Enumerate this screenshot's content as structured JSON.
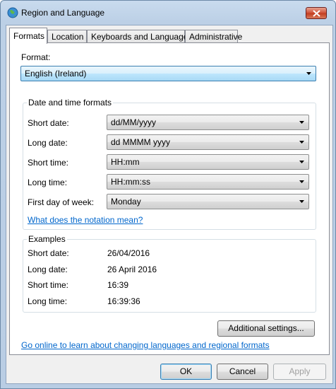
{
  "window": {
    "title": "Region and Language"
  },
  "tabs": [
    {
      "label": "Formats"
    },
    {
      "label": "Location"
    },
    {
      "label": "Keyboards and Languages"
    },
    {
      "label": "Administrative"
    }
  ],
  "format": {
    "label": "Format:",
    "value": "English (Ireland)"
  },
  "datetime": {
    "title": "Date and time formats",
    "short_date": {
      "label": "Short date:",
      "value": "dd/MM/yyyy"
    },
    "long_date": {
      "label": "Long date:",
      "value": "dd MMMM yyyy"
    },
    "short_time": {
      "label": "Short time:",
      "value": "HH:mm"
    },
    "long_time": {
      "label": "Long time:",
      "value": "HH:mm:ss"
    },
    "first_day": {
      "label": "First day of week:",
      "value": "Monday"
    },
    "notation_link": "What does the notation mean?"
  },
  "examples": {
    "title": "Examples",
    "short_date": {
      "label": "Short date:",
      "value": "26/04/2016"
    },
    "long_date": {
      "label": "Long date:",
      "value": "26 April 2016"
    },
    "short_time": {
      "label": "Short time:",
      "value": "16:39"
    },
    "long_time": {
      "label": "Long time:",
      "value": "16:39:36"
    }
  },
  "additional_settings": "Additional settings...",
  "online_link": "Go online to learn about changing languages and regional formats",
  "buttons": {
    "ok": "OK",
    "cancel": "Cancel",
    "apply": "Apply"
  }
}
